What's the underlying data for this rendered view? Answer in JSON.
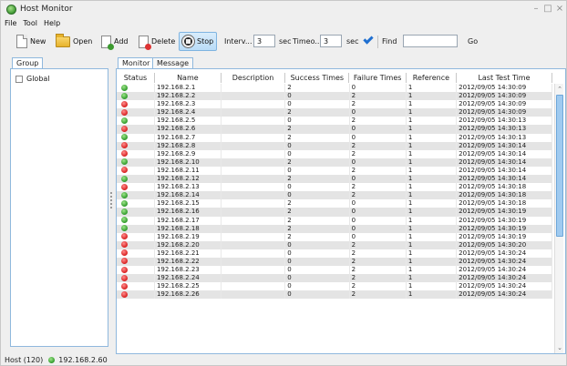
{
  "window": {
    "title": "Host Monitor"
  },
  "menu": {
    "items": [
      "File",
      "Tool",
      "Help"
    ]
  },
  "toolbar": {
    "new_label": "New",
    "open_label": "Open",
    "add_label": "Add",
    "delete_label": "Delete",
    "stop_label": "Stop",
    "interval_label": "Interv...",
    "interval_value": "3",
    "interval_unit": "sec",
    "timeout_label": "Timeo...",
    "timeout_value": "3",
    "timeout_unit": "sec",
    "find_label": "Find",
    "find_value": "",
    "go_label": "Go"
  },
  "left_panel": {
    "tab_label": "Group",
    "groups": [
      "Global"
    ]
  },
  "right_panel": {
    "tabs": [
      "Monitor",
      "Message"
    ],
    "columns": [
      "Status",
      "Name",
      "Description",
      "Success Times",
      "Failure Times",
      "Reference",
      "Last Test Time"
    ],
    "rows": [
      {
        "status": "ok",
        "name": "192.168.2.1",
        "description": "",
        "success": "2",
        "failure": "0",
        "reference": "1",
        "last_test": "2012/09/05 14:30:09"
      },
      {
        "status": "ok",
        "name": "192.168.2.2",
        "description": "",
        "success": "0",
        "failure": "2",
        "reference": "1",
        "last_test": "2012/09/05 14:30:09"
      },
      {
        "status": "fail",
        "name": "192.168.2.3",
        "description": "",
        "success": "0",
        "failure": "2",
        "reference": "1",
        "last_test": "2012/09/05 14:30:09"
      },
      {
        "status": "fail",
        "name": "192.168.2.4",
        "description": "",
        "success": "2",
        "failure": "0",
        "reference": "1",
        "last_test": "2012/09/05 14:30:09"
      },
      {
        "status": "ok",
        "name": "192.168.2.5",
        "description": "",
        "success": "0",
        "failure": "2",
        "reference": "1",
        "last_test": "2012/09/05 14:30:13"
      },
      {
        "status": "fail",
        "name": "192.168.2.6",
        "description": "",
        "success": "2",
        "failure": "0",
        "reference": "1",
        "last_test": "2012/09/05 14:30:13"
      },
      {
        "status": "ok",
        "name": "192.168.2.7",
        "description": "",
        "success": "2",
        "failure": "0",
        "reference": "1",
        "last_test": "2012/09/05 14:30:13"
      },
      {
        "status": "fail",
        "name": "192.168.2.8",
        "description": "",
        "success": "0",
        "failure": "2",
        "reference": "1",
        "last_test": "2012/09/05 14:30:14"
      },
      {
        "status": "fail",
        "name": "192.168.2.9",
        "description": "",
        "success": "0",
        "failure": "2",
        "reference": "1",
        "last_test": "2012/09/05 14:30:14"
      },
      {
        "status": "ok",
        "name": "192.168.2.10",
        "description": "",
        "success": "2",
        "failure": "0",
        "reference": "1",
        "last_test": "2012/09/05 14:30:14"
      },
      {
        "status": "fail",
        "name": "192.168.2.11",
        "description": "",
        "success": "0",
        "failure": "2",
        "reference": "1",
        "last_test": "2012/09/05 14:30:14"
      },
      {
        "status": "ok",
        "name": "192.168.2.12",
        "description": "",
        "success": "2",
        "failure": "0",
        "reference": "1",
        "last_test": "2012/09/05 14:30:14"
      },
      {
        "status": "fail",
        "name": "192.168.2.13",
        "description": "",
        "success": "0",
        "failure": "2",
        "reference": "1",
        "last_test": "2012/09/05 14:30:18"
      },
      {
        "status": "ok",
        "name": "192.168.2.14",
        "description": "",
        "success": "0",
        "failure": "2",
        "reference": "1",
        "last_test": "2012/09/05 14:30:18"
      },
      {
        "status": "ok",
        "name": "192.168.2.15",
        "description": "",
        "success": "2",
        "failure": "0",
        "reference": "1",
        "last_test": "2012/09/05 14:30:18"
      },
      {
        "status": "ok",
        "name": "192.168.2.16",
        "description": "",
        "success": "2",
        "failure": "0",
        "reference": "1",
        "last_test": "2012/09/05 14:30:19"
      },
      {
        "status": "ok",
        "name": "192.168.2.17",
        "description": "",
        "success": "2",
        "failure": "0",
        "reference": "1",
        "last_test": "2012/09/05 14:30:19"
      },
      {
        "status": "ok",
        "name": "192.168.2.18",
        "description": "",
        "success": "2",
        "failure": "0",
        "reference": "1",
        "last_test": "2012/09/05 14:30:19"
      },
      {
        "status": "fail",
        "name": "192.168.2.19",
        "description": "",
        "success": "2",
        "failure": "0",
        "reference": "1",
        "last_test": "2012/09/05 14:30:19"
      },
      {
        "status": "fail",
        "name": "192.168.2.20",
        "description": "",
        "success": "0",
        "failure": "2",
        "reference": "1",
        "last_test": "2012/09/05 14:30:20"
      },
      {
        "status": "fail",
        "name": "192.168.2.21",
        "description": "",
        "success": "0",
        "failure": "2",
        "reference": "1",
        "last_test": "2012/09/05 14:30:24"
      },
      {
        "status": "fail",
        "name": "192.168.2.22",
        "description": "",
        "success": "0",
        "failure": "2",
        "reference": "1",
        "last_test": "2012/09/05 14:30:24"
      },
      {
        "status": "fail",
        "name": "192.168.2.23",
        "description": "",
        "success": "0",
        "failure": "2",
        "reference": "1",
        "last_test": "2012/09/05 14:30:24"
      },
      {
        "status": "fail",
        "name": "192.168.2.24",
        "description": "",
        "success": "0",
        "failure": "2",
        "reference": "1",
        "last_test": "2012/09/05 14:30:24"
      },
      {
        "status": "fail",
        "name": "192.168.2.25",
        "description": "",
        "success": "0",
        "failure": "2",
        "reference": "1",
        "last_test": "2012/09/05 14:30:24"
      },
      {
        "status": "fail",
        "name": "192.168.2.26",
        "description": "",
        "success": "0",
        "failure": "2",
        "reference": "1",
        "last_test": "2012/09/05 14:30:24"
      }
    ]
  },
  "statusbar": {
    "host_count": "Host (120)",
    "current_host": "192.168.2.60"
  },
  "colors": {
    "ok": "#2f9a2a",
    "fail": "#d81f1f",
    "accent": "#1f6fd0",
    "row_alt": "#e4e4e4"
  }
}
